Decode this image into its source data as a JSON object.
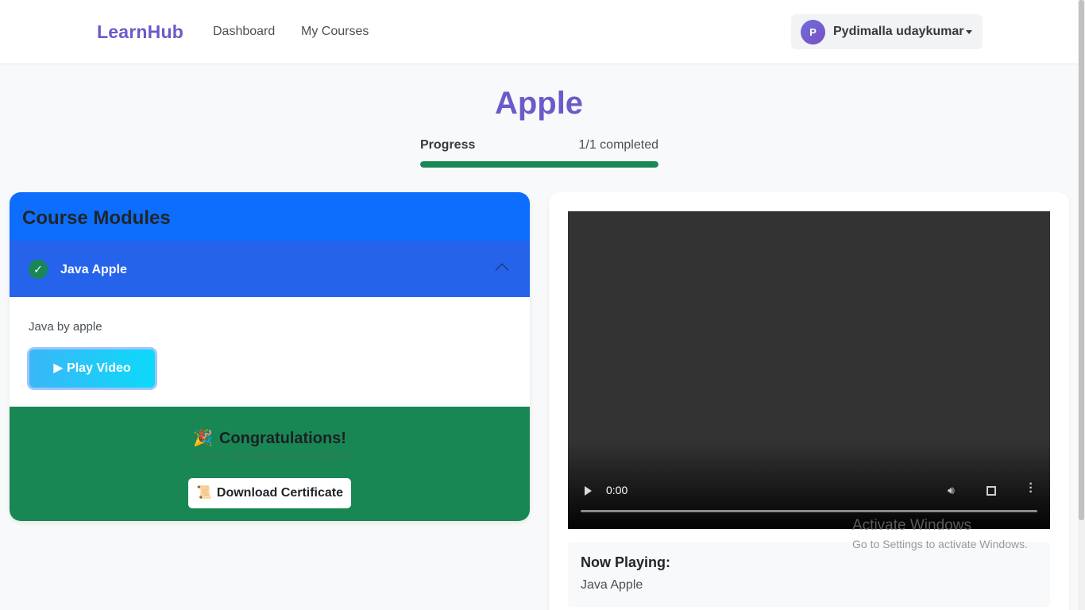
{
  "navbar": {
    "brand": "LearnHub",
    "links": [
      "Dashboard",
      "My Courses"
    ],
    "user": {
      "avatar_letter": "P",
      "name": "Pydimalla udaykumar"
    }
  },
  "course": {
    "title": "Apple",
    "progress_label": "Progress",
    "progress_text": "1/1 completed",
    "progress_fraction": 1.0
  },
  "modules": {
    "title": "Course Modules",
    "items": [
      {
        "name": "Java Apple",
        "completed": true,
        "check": "✓",
        "description": "Java by apple",
        "play_label": "▶ Play Video"
      }
    ],
    "congrats": {
      "icon": "🎉",
      "title": "Congratulations!",
      "subtitle": "You've completed all modules!",
      "certificate_icon": "📜",
      "certificate_label": "Download Certificate"
    }
  },
  "player": {
    "time": "0:00",
    "now_playing_label": "Now Playing:",
    "now_playing_title": "Java Apple"
  },
  "watermark": {
    "title": "Activate Windows",
    "subtitle": "Go to Settings to activate Windows."
  },
  "colors": {
    "brand": "#6b5ac9",
    "primary": "#0d6efd",
    "success": "#198754"
  }
}
